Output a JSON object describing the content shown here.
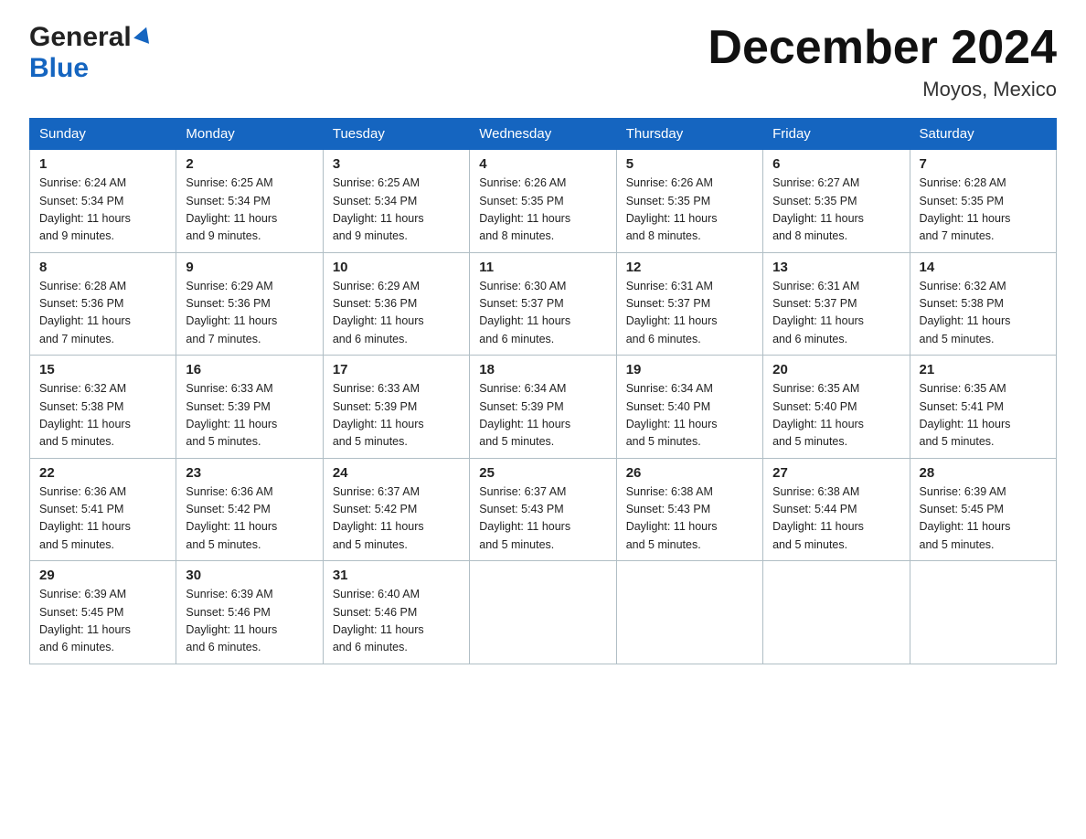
{
  "header": {
    "logo_general": "General",
    "logo_blue": "Blue",
    "title": "December 2024",
    "location": "Moyos, Mexico"
  },
  "days_of_week": [
    "Sunday",
    "Monday",
    "Tuesday",
    "Wednesday",
    "Thursday",
    "Friday",
    "Saturday"
  ],
  "weeks": [
    [
      {
        "day": "1",
        "sunrise": "6:24 AM",
        "sunset": "5:34 PM",
        "daylight": "11 hours and 9 minutes."
      },
      {
        "day": "2",
        "sunrise": "6:25 AM",
        "sunset": "5:34 PM",
        "daylight": "11 hours and 9 minutes."
      },
      {
        "day": "3",
        "sunrise": "6:25 AM",
        "sunset": "5:34 PM",
        "daylight": "11 hours and 9 minutes."
      },
      {
        "day": "4",
        "sunrise": "6:26 AM",
        "sunset": "5:35 PM",
        "daylight": "11 hours and 8 minutes."
      },
      {
        "day": "5",
        "sunrise": "6:26 AM",
        "sunset": "5:35 PM",
        "daylight": "11 hours and 8 minutes."
      },
      {
        "day": "6",
        "sunrise": "6:27 AM",
        "sunset": "5:35 PM",
        "daylight": "11 hours and 8 minutes."
      },
      {
        "day": "7",
        "sunrise": "6:28 AM",
        "sunset": "5:35 PM",
        "daylight": "11 hours and 7 minutes."
      }
    ],
    [
      {
        "day": "8",
        "sunrise": "6:28 AM",
        "sunset": "5:36 PM",
        "daylight": "11 hours and 7 minutes."
      },
      {
        "day": "9",
        "sunrise": "6:29 AM",
        "sunset": "5:36 PM",
        "daylight": "11 hours and 7 minutes."
      },
      {
        "day": "10",
        "sunrise": "6:29 AM",
        "sunset": "5:36 PM",
        "daylight": "11 hours and 6 minutes."
      },
      {
        "day": "11",
        "sunrise": "6:30 AM",
        "sunset": "5:37 PM",
        "daylight": "11 hours and 6 minutes."
      },
      {
        "day": "12",
        "sunrise": "6:31 AM",
        "sunset": "5:37 PM",
        "daylight": "11 hours and 6 minutes."
      },
      {
        "day": "13",
        "sunrise": "6:31 AM",
        "sunset": "5:37 PM",
        "daylight": "11 hours and 6 minutes."
      },
      {
        "day": "14",
        "sunrise": "6:32 AM",
        "sunset": "5:38 PM",
        "daylight": "11 hours and 5 minutes."
      }
    ],
    [
      {
        "day": "15",
        "sunrise": "6:32 AM",
        "sunset": "5:38 PM",
        "daylight": "11 hours and 5 minutes."
      },
      {
        "day": "16",
        "sunrise": "6:33 AM",
        "sunset": "5:39 PM",
        "daylight": "11 hours and 5 minutes."
      },
      {
        "day": "17",
        "sunrise": "6:33 AM",
        "sunset": "5:39 PM",
        "daylight": "11 hours and 5 minutes."
      },
      {
        "day": "18",
        "sunrise": "6:34 AM",
        "sunset": "5:39 PM",
        "daylight": "11 hours and 5 minutes."
      },
      {
        "day": "19",
        "sunrise": "6:34 AM",
        "sunset": "5:40 PM",
        "daylight": "11 hours and 5 minutes."
      },
      {
        "day": "20",
        "sunrise": "6:35 AM",
        "sunset": "5:40 PM",
        "daylight": "11 hours and 5 minutes."
      },
      {
        "day": "21",
        "sunrise": "6:35 AM",
        "sunset": "5:41 PM",
        "daylight": "11 hours and 5 minutes."
      }
    ],
    [
      {
        "day": "22",
        "sunrise": "6:36 AM",
        "sunset": "5:41 PM",
        "daylight": "11 hours and 5 minutes."
      },
      {
        "day": "23",
        "sunrise": "6:36 AM",
        "sunset": "5:42 PM",
        "daylight": "11 hours and 5 minutes."
      },
      {
        "day": "24",
        "sunrise": "6:37 AM",
        "sunset": "5:42 PM",
        "daylight": "11 hours and 5 minutes."
      },
      {
        "day": "25",
        "sunrise": "6:37 AM",
        "sunset": "5:43 PM",
        "daylight": "11 hours and 5 minutes."
      },
      {
        "day": "26",
        "sunrise": "6:38 AM",
        "sunset": "5:43 PM",
        "daylight": "11 hours and 5 minutes."
      },
      {
        "day": "27",
        "sunrise": "6:38 AM",
        "sunset": "5:44 PM",
        "daylight": "11 hours and 5 minutes."
      },
      {
        "day": "28",
        "sunrise": "6:39 AM",
        "sunset": "5:45 PM",
        "daylight": "11 hours and 5 minutes."
      }
    ],
    [
      {
        "day": "29",
        "sunrise": "6:39 AM",
        "sunset": "5:45 PM",
        "daylight": "11 hours and 6 minutes."
      },
      {
        "day": "30",
        "sunrise": "6:39 AM",
        "sunset": "5:46 PM",
        "daylight": "11 hours and 6 minutes."
      },
      {
        "day": "31",
        "sunrise": "6:40 AM",
        "sunset": "5:46 PM",
        "daylight": "11 hours and 6 minutes."
      },
      null,
      null,
      null,
      null
    ]
  ],
  "labels": {
    "sunrise": "Sunrise:",
    "sunset": "Sunset:",
    "daylight": "Daylight:"
  }
}
